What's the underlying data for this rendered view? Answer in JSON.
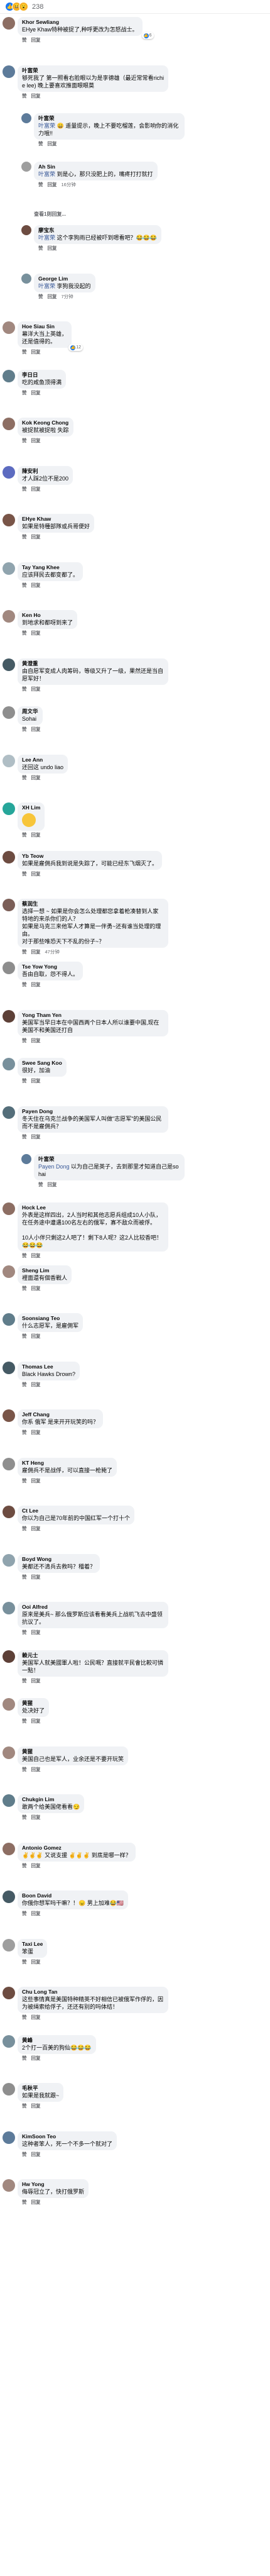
{
  "reactions": {
    "count": "238"
  },
  "comments": [
    {
      "id": "c1",
      "level": 0,
      "author": "Khor Sewliang",
      "text": "EHye Khaw特种被捉了,种呼更改为怎怒战士。",
      "time": "",
      "likes": "6",
      "avatar_color": "#8d6e63"
    },
    {
      "id": "c2",
      "level": 0,
      "author": "叶富荣",
      "text": "够死我了 第一照看右脸眼以为是李德雄（最近常常看richie lee) 晚上要喜欢推面眼眼莫",
      "time": "",
      "likes": "",
      "avatar_color": "#5d7b9a"
    },
    {
      "id": "c3",
      "level": 1,
      "author": "叶富荣",
      "mention": "叶富荣",
      "text": "😄 遥量提示，晚上不要吃榴莲，会影响你的消化力哦!!",
      "time": "",
      "likes": "",
      "avatar_color": "#5d7b9a"
    },
    {
      "id": "c4",
      "level": 1,
      "author": "Ah Sin",
      "mention": "叶富荣",
      "text": "到是心，那只没肥上的，嘴疼打打就打",
      "time": "16分钟",
      "likes": "",
      "avatar_color": "#9e9e9e"
    },
    {
      "id": "c4r",
      "level": 1,
      "replies": "查看1则回复..."
    },
    {
      "id": "c5",
      "level": 1,
      "author": "廖宝东",
      "mention": "叶富荣",
      "text": "这个李狗雨已经被吓到嗯看吧？😂😂😂",
      "time": "",
      "likes": "",
      "avatar_color": "#6d4c41"
    },
    {
      "id": "c6",
      "level": 1,
      "author": "George Lim",
      "mention": "叶富荣",
      "text": "李狗我没起的",
      "time": "7分钟",
      "likes": "",
      "avatar_color": "#78909c"
    },
    {
      "id": "c7",
      "level": 0,
      "author": "Hoe Siau Sin",
      "text": "幕洋大当上英雄，\n还是值得的。",
      "time": "",
      "likes": "12",
      "avatar_color": "#a1887f"
    },
    {
      "id": "c8",
      "level": 0,
      "author": "李日日",
      "text": "吃的咸鱼顶得满",
      "time": "",
      "likes": "",
      "avatar_color": "#607d8b"
    },
    {
      "id": "c9",
      "level": 0,
      "author": "Kok Keong Chong",
      "text": "被捉就被捉啦 失踪",
      "time": "",
      "likes": "",
      "avatar_color": "#8d6e63"
    },
    {
      "id": "c10",
      "level": 0,
      "author": "陳安利",
      "text": "才人踩2位不是200",
      "time": "",
      "likes": "",
      "avatar_color": "#5c6bc0"
    },
    {
      "id": "c11",
      "level": 0,
      "author": "EHye Khaw",
      "text": "如果是特種部隊或兵哥便好",
      "time": "",
      "likes": "",
      "avatar_color": "#795548"
    },
    {
      "id": "c12",
      "level": 0,
      "author": "Tay Yang Khee",
      "text": "应该拜民去都变都了。",
      "time": "",
      "likes": "",
      "avatar_color": "#90a4ae"
    },
    {
      "id": "c13",
      "level": 0,
      "author": "Ken Ho",
      "text": "到地求和都呀到来了",
      "time": "",
      "likes": "",
      "avatar_color": "#a1887f"
    },
    {
      "id": "c14",
      "level": 0,
      "author": "黄澄重",
      "text": "由自愿军变成人肉筹码，等级又升了一级，果然还是当自愿军好！",
      "time": "",
      "likes": "",
      "avatar_color": "#455a64"
    },
    {
      "id": "c15",
      "level": 0,
      "author": "周文华",
      "text": "Sohai",
      "time": "",
      "likes": "",
      "avatar_color": "#8e8e8e"
    },
    {
      "id": "c16",
      "level": 0,
      "author": "Lee Ann",
      "text": "还回这 undo liao",
      "time": "",
      "likes": "",
      "avatar_color": "#b0bec5"
    },
    {
      "id": "c17",
      "level": 0,
      "author": "XH Lim",
      "text": "",
      "sticker": true,
      "time": "",
      "likes": "",
      "avatar_color": "#26a69a"
    },
    {
      "id": "c18",
      "level": 0,
      "author": "Yb Teow",
      "text": "如果是雇佣兵我到说是失踪了，可能已经东飞烟灭了。",
      "time": "",
      "likes": "",
      "avatar_color": "#6d4c41"
    },
    {
      "id": "c19",
      "level": 0,
      "author": "蔡润生",
      "text": "选择一想 ~ 如果是你会怎么处理都您拿着枪凑替到人家特地的来杀你们的人？\n如果是马克三来他军人才算是一伴勇~还有谁当处理的理由。\n对于那些唯恐天下不乱的份子~？",
      "time": "47分钟",
      "likes": "",
      "avatar_color": "#7b5e57"
    },
    {
      "id": "c20",
      "level": 0,
      "author": "Tse Yow Yong",
      "text": "吾由自取，怨不得人。",
      "time": "",
      "likes": "",
      "avatar_color": "#8d8d8d"
    },
    {
      "id": "c21",
      "level": 0,
      "author": "Yong Tham Yen",
      "text": "美国军当早日本在中国西两个日本人所以谁要中国,现在美国不和美国还打自",
      "time": "",
      "likes": "",
      "avatar_color": "#5d4037"
    },
    {
      "id": "c22",
      "level": 0,
      "author": "Swee Sang Koo",
      "text": "很好，加油",
      "time": "",
      "likes": "",
      "avatar_color": "#78909c"
    },
    {
      "id": "c23",
      "level": 0,
      "author": "Payen Dong",
      "text": "冬天住在乌克兰战争的美国军人叫做\"志愿军\"的美国公民而不是雇佣兵？",
      "time": "",
      "likes": "",
      "avatar_color": "#546e7a"
    },
    {
      "id": "c24",
      "level": 1,
      "author": "叶富荣",
      "mention": "Payen Dong",
      "text": "以为自己是英子，去到那里才知道自己是sohai",
      "time": "",
      "likes": "",
      "avatar_color": "#5d7b9a"
    },
    {
      "id": "c25",
      "level": 0,
      "author": "Hock Lee",
      "text": "外表是这样四出，2人当时和其他志愿兵组成10人小队，在任务途中遭遇100名左右的俄军，寡不敌众而被俘。\n\n10人小伴只剩这2人吧了！剩下8人呢？这2人比较香吧！😂😂😂",
      "time": "",
      "likes": "",
      "avatar_color": "#8d6e63"
    },
    {
      "id": "c26",
      "level": 0,
      "author": "Sheng Lim",
      "text": "裡面還有個香戰人",
      "time": "",
      "likes": "",
      "avatar_color": "#a1887f"
    },
    {
      "id": "c27",
      "level": 0,
      "author": "Soonsiang Teo",
      "text": "什么志愿军，是雇佣军",
      "time": "",
      "likes": "",
      "avatar_color": "#607d8b"
    },
    {
      "id": "c28",
      "level": 0,
      "author": "Thomas Lee",
      "text": "Black Hawks Drown?",
      "time": "",
      "likes": "",
      "avatar_color": "#455a64"
    },
    {
      "id": "c29",
      "level": 0,
      "author": "Jeff Chang",
      "text": "你系 俄军 是来开开玩笑的吗？",
      "time": "",
      "likes": "",
      "avatar_color": "#795548"
    },
    {
      "id": "c30",
      "level": 0,
      "author": "KT Heng",
      "text": "雇佣兵不是战俘，可以直接一枪毙了",
      "time": "",
      "likes": "",
      "avatar_color": "#8e8e8e"
    },
    {
      "id": "c31",
      "level": 0,
      "author": "Ct Lee",
      "text": "你以为自己是70年前的中国红军一个打十个",
      "time": "",
      "likes": "",
      "avatar_color": "#6d4c41"
    },
    {
      "id": "c32",
      "level": 0,
      "author": "Boyd Wong",
      "text": "美都还不清兵去救吗？稽着？",
      "time": "",
      "likes": "",
      "avatar_color": "#90a4ae"
    },
    {
      "id": "c33",
      "level": 0,
      "author": "Ooi Alfred",
      "text": "原来是美兵~ 那么俄罗斯应该看看美兵上战机飞去中盛领抗议了。",
      "time": "",
      "likes": "",
      "avatar_color": "#78909c"
    },
    {
      "id": "c34",
      "level": 0,
      "author": "赖元士",
      "text": "美国军人就美國軍人啦！公民嘅？直接就平民會比較可憐一點！",
      "time": "",
      "likes": "",
      "avatar_color": "#5d4037"
    },
    {
      "id": "c35",
      "level": 0,
      "author": "黄猩",
      "text": "处决好了",
      "time": "",
      "likes": "",
      "avatar_color": "#a1887f"
    },
    {
      "id": "c36",
      "level": 0,
      "author": "黄猩",
      "text": "美国自己也是军人，业余还是不要开玩笑",
      "time": "",
      "likes": "",
      "avatar_color": "#a1887f"
    },
    {
      "id": "c37",
      "level": 0,
      "author": "Chukgin Lim",
      "text": "敢两个给美国佬看看😏",
      "time": "",
      "likes": "",
      "avatar_color": "#607d8b"
    },
    {
      "id": "c38",
      "level": 0,
      "author": "Antonio Gomez",
      "text": "✌️✌️✌️ 又说支援 ✌️✌️✌️ 到底是哪一样？",
      "time": "",
      "likes": "",
      "avatar_color": "#8d6e63"
    },
    {
      "id": "c39",
      "level": 0,
      "author": "Boon David",
      "text": "你俄你想军吗干嘛？！😠 男上加难😂🇺🇸",
      "time": "",
      "likes": "",
      "avatar_color": "#455a64"
    },
    {
      "id": "c40",
      "level": 0,
      "author": "Taxi Lee",
      "text": "笨蛋",
      "time": "",
      "likes": "",
      "avatar_color": "#9e9e9e"
    },
    {
      "id": "c41",
      "level": 0,
      "author": "Chu Long Tan",
      "text": "这些事情真是美国特种精英不好相信已被俄军作俘的，因为被绳索给俘子，还还有别的吗体结！",
      "time": "",
      "likes": "",
      "avatar_color": "#6d4c41"
    },
    {
      "id": "c42",
      "level": 0,
      "author": "黄峰",
      "text": "2个打一百美的狗仙😂😂😂",
      "time": "",
      "likes": "",
      "avatar_color": "#78909c"
    },
    {
      "id": "c43",
      "level": 0,
      "author": "毛秋平",
      "text": "如果是我就跟~",
      "time": "",
      "likes": "",
      "avatar_color": "#8e8e8e"
    },
    {
      "id": "c44",
      "level": 0,
      "author": "KimSoon Teo",
      "text": "这种者笨人，死一个不多一个就对了",
      "time": "",
      "likes": "",
      "avatar_color": "#5d7b9a"
    },
    {
      "id": "c45",
      "level": 0,
      "author": "Hw Yong",
      "text": "侮辱冠立了，快打俄罗斯",
      "time": "",
      "likes": "",
      "avatar_color": "#a1887f"
    }
  ],
  "actions": {
    "like": "赞",
    "reply": "回复"
  }
}
